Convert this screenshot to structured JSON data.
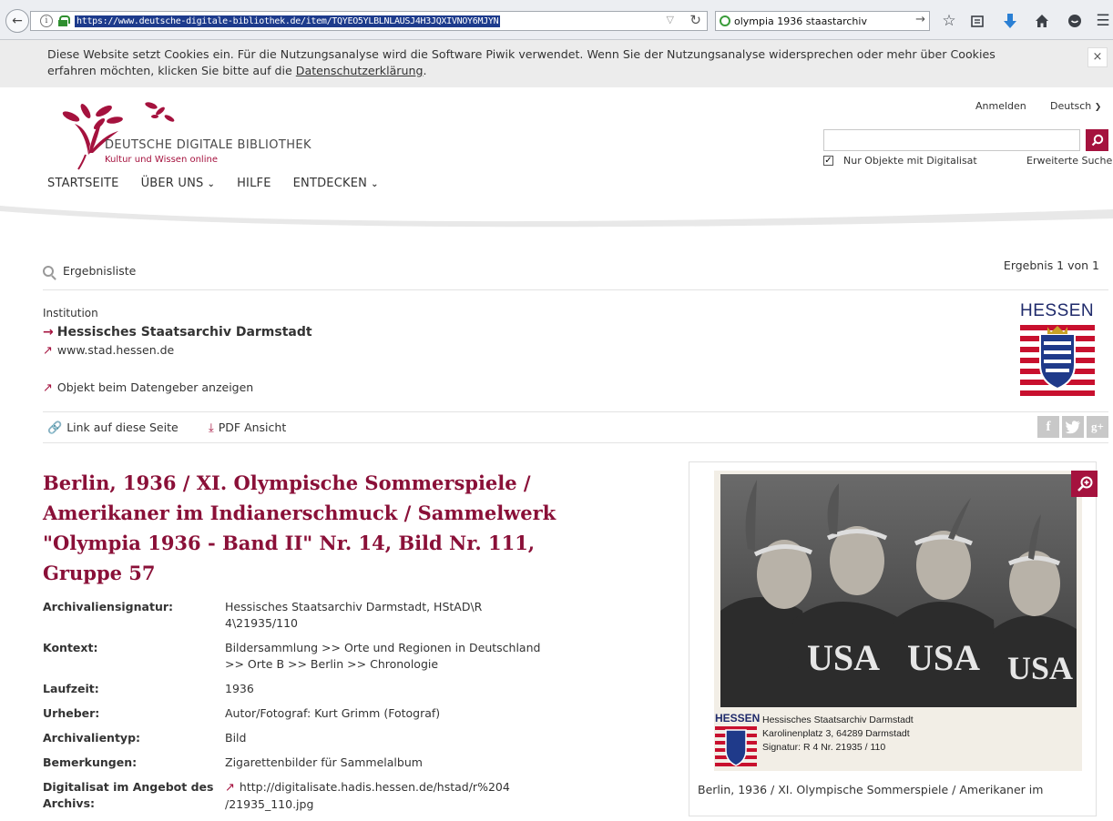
{
  "browser": {
    "url": "https://www.deutsche-digitale-bibliothek.de/item/TQYEO5YLBLNLAUSJ4H3JQXIVNOY6MJYN",
    "search_query": "olympia 1936 staastarchiv"
  },
  "cookie_banner": {
    "text": "Diese Website setzt Cookies ein. Für die Nutzungsanalyse wird die Software Piwik verwendet. Wenn Sie der Nutzungsanalyse widersprechen oder mehr über Cookies erfahren möchten, klicken Sie bitte auf die ",
    "link": "Datenschutzerklärung",
    "after": ".",
    "close": "×"
  },
  "header": {
    "logo_title": "DEUTSCHE DIGITALE BIBLIOTHEK",
    "logo_subtitle": "Kultur und Wissen online",
    "login": "Anmelden",
    "language": "Deutsch",
    "only_digitized": "Nur Objekte mit Digitalisat",
    "advanced_search": "Erweiterte Suche",
    "nav": [
      "STARTSEITE",
      "ÜBER UNS",
      "HILFE",
      "ENTDECKEN"
    ]
  },
  "result": {
    "back_to_list": "Ergebnisliste",
    "count": "Ergebnis 1 von 1"
  },
  "institution": {
    "label": "Institution",
    "name": "Hessisches Staatsarchiv Darmstadt",
    "url": "www.stad.hessen.de",
    "view_at_provider": "Objekt beim Datengeber anzeigen",
    "logo_text": "HESSEN"
  },
  "actions": {
    "link_page": "Link auf diese Seite",
    "pdf": "PDF Ansicht",
    "social": [
      "f",
      "t",
      "g+"
    ]
  },
  "object": {
    "title": "Berlin, 1936 / XI. Olympische Sommerspiele / Amerikaner im Indianerschmuck / Sammelwerk \"Olympia 1936 - Band II\" Nr. 14, Bild Nr. 111, Gruppe 57",
    "details": [
      {
        "k": "Archivaliensignatur:",
        "v": "Hessisches Staatsarchiv Darmstadt, HStAD\\R 4\\21935/110"
      },
      {
        "k": "Kontext:",
        "v": "Bildersammlung >> Orte und Regionen in Deutschland >> Orte B >> Berlin >> Chronologie"
      },
      {
        "k": "Laufzeit:",
        "v": "1936"
      },
      {
        "k": "Urheber:",
        "v": "Autor/Fotograf: Kurt Grimm (Fotograf)"
      },
      {
        "k": "Archivalientyp:",
        "v": "Bild"
      },
      {
        "k": "Bemerkungen:",
        "v": "Zigarettenbilder für Sammelalbum"
      },
      {
        "k": "Digitalisat im Angebot des Archivs:",
        "v": "http://digitalisate.hadis.hessen.de/hstad/r%204 /21935_110.jpg"
      }
    ]
  },
  "image": {
    "jersey": "USA",
    "stamp_logo": "HESSEN",
    "stamp_lines": [
      "Hessisches Staatsarchiv Darmstadt",
      "Karolinenplatz 3, 64289 Darmstadt",
      "Signatur: R 4 Nr. 21935 / 110"
    ],
    "caption": "Berlin, 1936 / XI. Olympische Sommerspiele / Amerikaner im"
  }
}
